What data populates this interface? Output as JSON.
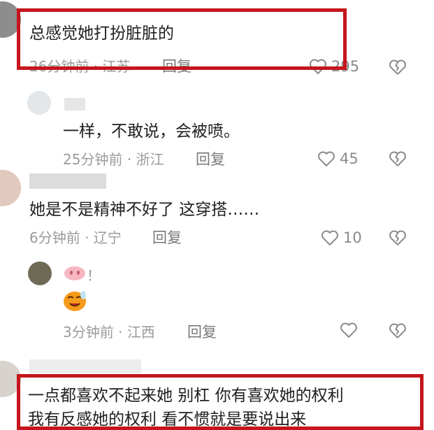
{
  "comments": [
    {
      "text": "总感觉她打扮脏脏的",
      "time": "26分钟前",
      "location": "江苏",
      "reply": "回复",
      "likes": "295"
    },
    {
      "text": "一样，不敢说，会被喷。",
      "time": "25分钟前",
      "location": "浙江",
      "reply": "回复",
      "likes": "45"
    },
    {
      "text": "她是不是精神不好了 这穿搭……",
      "time": "6分钟前",
      "location": "辽宁",
      "reply": "回复",
      "likes": "10"
    },
    {
      "text": "！",
      "time": "3分钟前",
      "location": "江西",
      "reply": "回复",
      "likes": ""
    },
    {
      "text_line1": "一点都喜欢不起来她  别杠 你有喜欢她的权利",
      "text_line2": "我有反感她的权利  看不惯就是要说出来"
    }
  ],
  "meta_separator": " · ",
  "icons": {
    "like": "heart-outline-icon",
    "dislike": "broken-heart-icon",
    "emoji_pig": "pig-nose-emoji",
    "emoji_face": "crying-face-emoji"
  },
  "colors": {
    "highlight_box": "#c4161c",
    "meta_gray": "#9a9a9a"
  }
}
